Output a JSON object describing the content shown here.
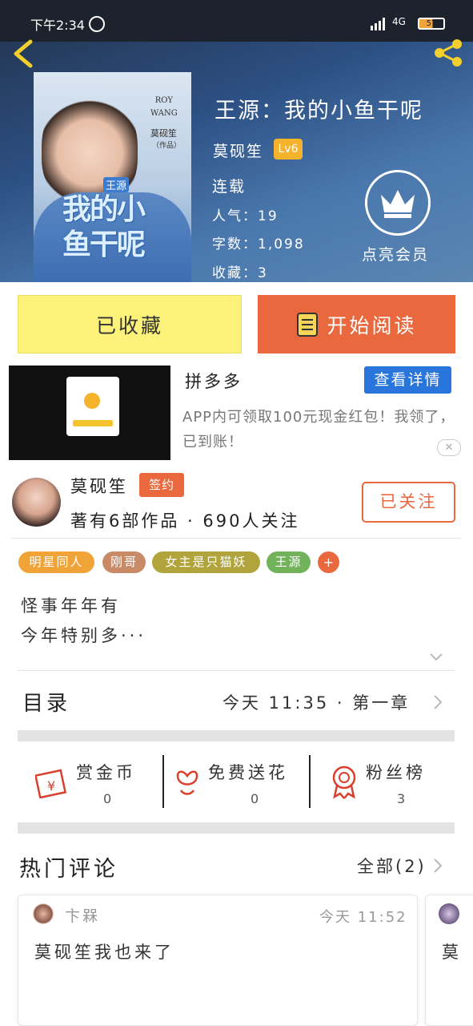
{
  "status": {
    "time": "下午2:34",
    "network": "4G",
    "battery": "57"
  },
  "book": {
    "title": "王源：我的小鱼干呢",
    "author": "莫砚笙",
    "level": "Lv6",
    "state": "连载",
    "popularity": "人气：19",
    "words": "字数：1,098",
    "favorites": "收藏：3",
    "vip_label": "点亮会员",
    "cover_text": {
      "en": "ROY\nWANG",
      "author": "莫砚笙",
      "note": "（作品）",
      "subtitle": "王源",
      "big": "我的小鱼干呢"
    }
  },
  "actions": {
    "favorited_label": "已收藏",
    "read_label": "开始阅读"
  },
  "ad": {
    "title": "拼多多",
    "button": "查看详情",
    "desc": "APP内可领取100元现金红包！我领了，已到账！",
    "close": "✕"
  },
  "author_info": {
    "name": "莫砚笙",
    "badge": "签约",
    "meta": "著有6部作品 · 690人关注",
    "follow_label": "已关注"
  },
  "tags": [
    "明星同人",
    "刚哥",
    "女主是只猫妖",
    "王源",
    "+"
  ],
  "description": [
    "怪事年年有",
    "今年特别多···"
  ],
  "toc": {
    "label": "目录",
    "latest": "今天  11:35  ·  第一章"
  },
  "rewards": [
    {
      "label": "赏金币",
      "value": "0",
      "icon": "coin-envelope-icon"
    },
    {
      "label": "免费送花",
      "value": "0",
      "icon": "flower-icon"
    },
    {
      "label": "粉丝榜",
      "value": "3",
      "icon": "medal-icon"
    }
  ],
  "comments": {
    "title": "热门评论",
    "all_label": "全部(2)",
    "items": [
      {
        "user": "卞槑",
        "time": "今天  11:52",
        "text": "莫砚笙我也来了"
      },
      {
        "user": "",
        "time": "",
        "text": "莫"
      }
    ]
  },
  "colors": {
    "accent": "#e9683e",
    "favorite_yellow": "#fcf27a",
    "ad_blue": "#2875dc"
  }
}
